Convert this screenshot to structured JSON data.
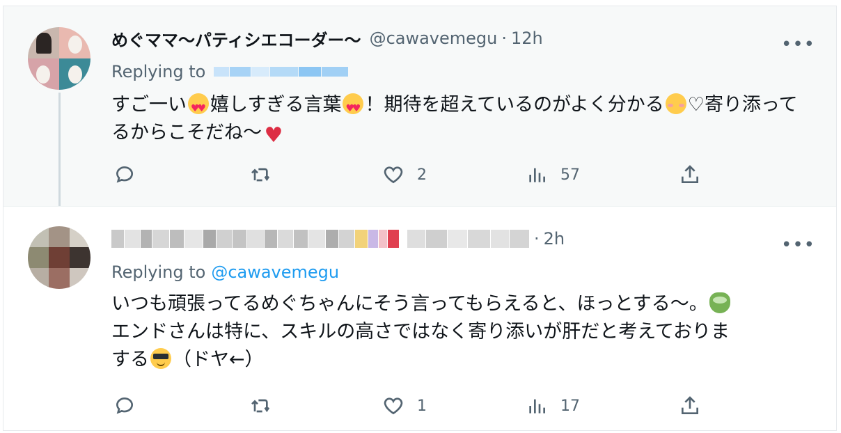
{
  "tweets": [
    {
      "author_name": "めぐママ〜パティシエコーダー〜",
      "handle": "@cawavemegu",
      "separator": "·",
      "time": "12h",
      "replying_to_label": "Replying to",
      "replying_to_handle_redacted": true,
      "body_parts": [
        "すご一い",
        "嬉しすぎる言葉",
        "！期待を超えているのがよく分かる",
        "♡寄り添ってるからこそだね〜"
      ],
      "emojis": [
        "heart-eyes",
        "heart-eyes",
        "blush",
        "heart"
      ],
      "stats": {
        "replies": "",
        "retweets": "",
        "likes": "2",
        "views": "57"
      }
    },
    {
      "author_name_redacted": true,
      "separator": "·",
      "time": "2h",
      "replying_to_label": "Replying to",
      "replying_to_handle": "@cawavemegu",
      "body_parts": [
        "いつも頑張ってるめぐちゃんにそう言ってもらえると、ほっとする〜。",
        "エンドさんは特に、スキルの高さではなく寄り添いが肝だと考えておりま",
        "する",
        "（ドヤ←）"
      ],
      "emojis": [
        "tea",
        "cool"
      ],
      "stats": {
        "replies": "",
        "retweets": "",
        "likes": "1",
        "views": "17"
      }
    }
  ],
  "colors": {
    "accent": "#1d9bf0",
    "secondary_text": "#536471",
    "highlight_bg": "#f7f9f9"
  },
  "icons": [
    "reply-icon",
    "retweet-icon",
    "like-icon",
    "views-icon",
    "share-icon",
    "more-icon"
  ]
}
